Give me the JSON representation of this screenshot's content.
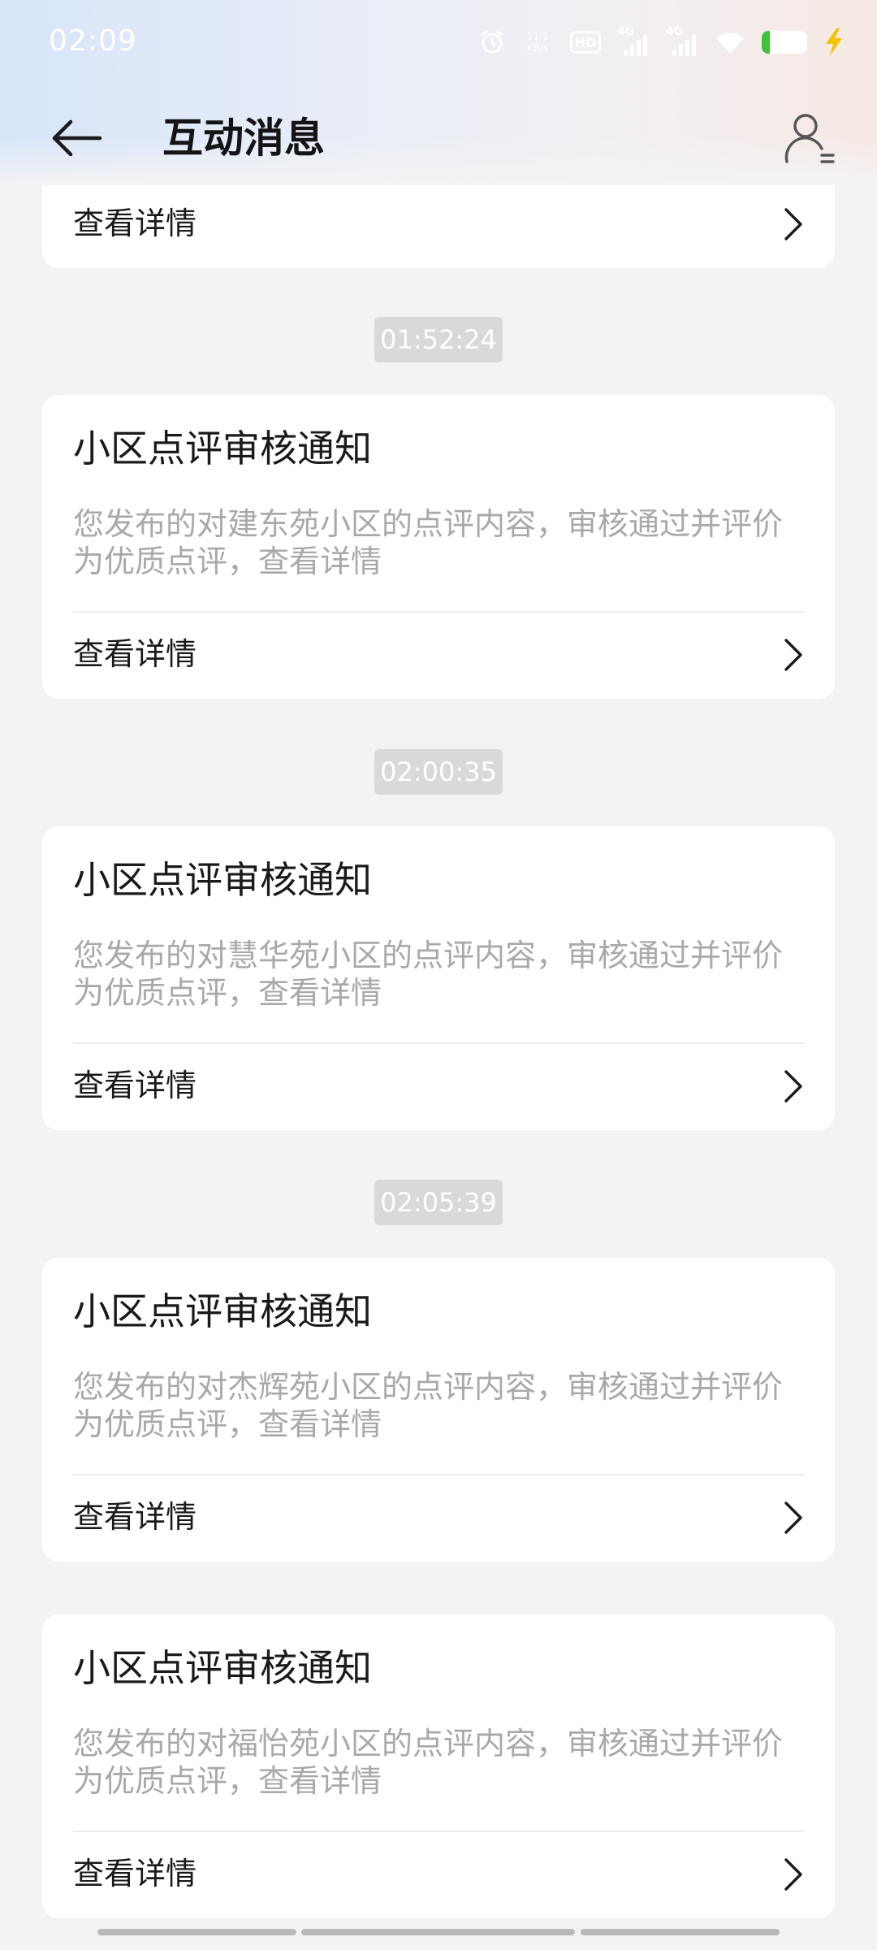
{
  "status_bar": {
    "time": "02:09",
    "net_speed_value": "11.1",
    "net_speed_unit": "KB/s",
    "hd_label": "HD",
    "sim1_label": "4G",
    "sim2_label": "4G",
    "battery_level_percent": 18,
    "icons": [
      "alarm-icon",
      "hd-icon",
      "signal-icon",
      "wifi-icon",
      "battery-icon",
      "charging-icon"
    ]
  },
  "nav": {
    "title": "互动消息"
  },
  "partial_card": {
    "detail_label": "查看详情"
  },
  "messages": [
    {
      "time": "01:52:24",
      "title": "小区点评审核通知",
      "desc": "您发布的对建东苑小区的点评内容，审核通过并评价为优质点评，查看详情",
      "detail_label": "查看详情"
    },
    {
      "time": "02:00:35",
      "title": "小区点评审核通知",
      "desc": "您发布的对慧华苑小区的点评内容，审核通过并评价为优质点评，查看详情",
      "detail_label": "查看详情"
    },
    {
      "time": "02:05:39",
      "title": "小区点评审核通知",
      "desc": "您发布的对杰辉苑小区的点评内容，审核通过并评价为优质点评，查看详情",
      "detail_label": "查看详情"
    },
    {
      "title": "小区点评审核通知",
      "desc": "您发布的对福怡苑小区的点评内容，审核通过并评价为优质点评，查看详情",
      "detail_label": "查看详情"
    }
  ],
  "colors": {
    "page_bg": "#f3f3f4",
    "card_bg": "#ffffff",
    "title_text": "#1a1a1a",
    "desc_text": "#a9a9ab",
    "timestamp_bg": "#d9d9d9",
    "battery_fill": "#3ec23a",
    "charging_bolt": "#f5c400"
  }
}
